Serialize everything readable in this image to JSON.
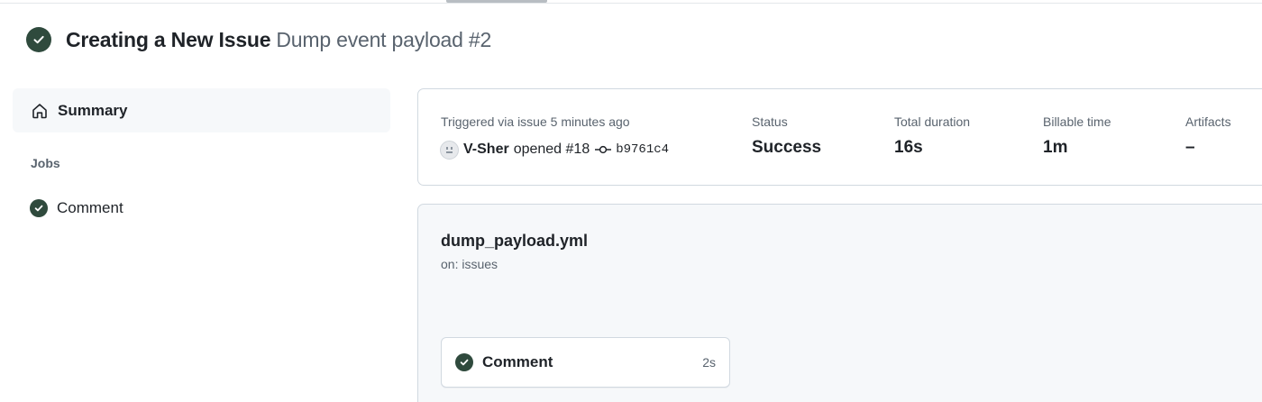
{
  "header": {
    "title": "Creating a New Issue",
    "subtitle": "Dump event payload #2",
    "status_icon": "check-circle-fill-icon"
  },
  "sidebar": {
    "summary_label": "Summary",
    "summary_icon": "home-icon",
    "jobs_heading": "Jobs",
    "jobs": [
      {
        "label": "Comment",
        "status": "success"
      }
    ]
  },
  "summary": {
    "triggered_text": "Triggered via issue 5 minutes ago",
    "actor": "V-Sher",
    "action": "opened #18",
    "commit_sha": "b9761c4",
    "stats": [
      {
        "label": "Status",
        "value": "Success"
      },
      {
        "label": "Total duration",
        "value": "16s"
      },
      {
        "label": "Billable time",
        "value": "1m"
      },
      {
        "label": "Artifacts",
        "value": "–"
      }
    ]
  },
  "workflow": {
    "file_name": "dump_payload.yml",
    "trigger": "on: issues",
    "jobs": [
      {
        "label": "Comment",
        "duration": "2s",
        "status": "success"
      }
    ]
  },
  "colors": {
    "success_dark": "#2f4a3d",
    "text_primary": "#1f2328",
    "text_muted": "#59636e",
    "border": "#d1d9e0",
    "panel_bg": "#f6f8fa"
  }
}
